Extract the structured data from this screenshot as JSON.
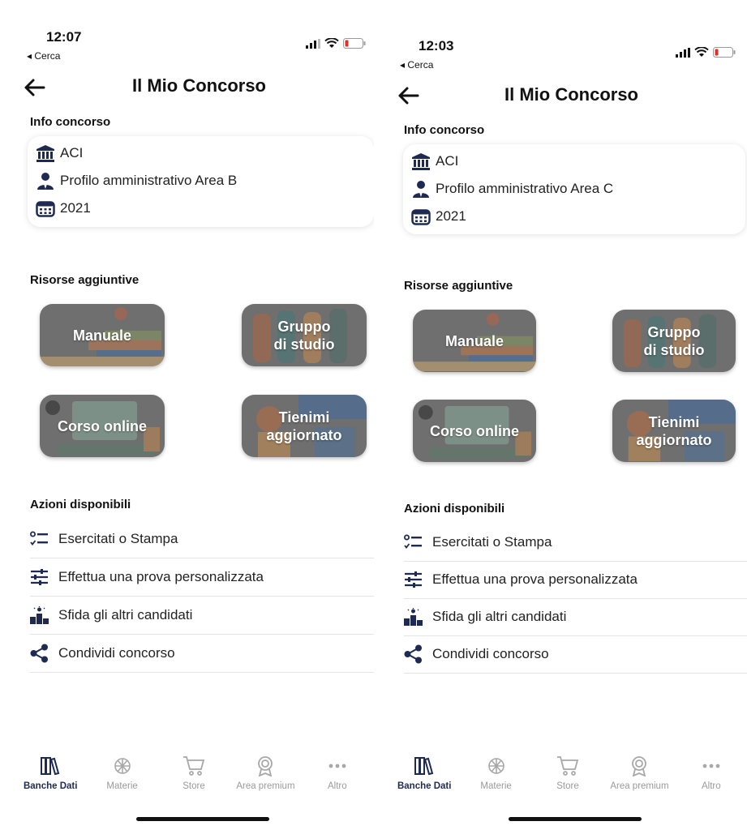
{
  "screens": [
    {
      "status": {
        "time": "12:07",
        "back_app": "◂ Cerca"
      },
      "header": {
        "title": "Il Mio Concorso"
      },
      "info": {
        "section_label": "Info concorso",
        "ente": "ACI",
        "profilo": "Profilo amministrativo Area B",
        "anno": "2021"
      },
      "resources": {
        "section_label": "Risorse aggiuntive",
        "manuale": "Manuale",
        "gruppo": "Gruppo\ndi studio",
        "corso": "Corso online",
        "tienimi": "Tienimi\naggiornato"
      },
      "actions": {
        "section_label": "Azioni disponibili",
        "items": [
          "Esercitati o Stampa",
          "Effettua una prova personalizzata",
          "Sfida gli altri candidati",
          "Condividi concorso"
        ]
      },
      "tabs": [
        "Banche Dati",
        "Materie",
        "Store",
        "Area premium",
        "Altro"
      ]
    },
    {
      "status": {
        "time": "12:03",
        "back_app": "◂ Cerca"
      },
      "header": {
        "title": "Il Mio Concorso"
      },
      "info": {
        "section_label": "Info concorso",
        "ente": "ACI",
        "profilo": "Profilo amministrativo Area C",
        "anno": "2021"
      },
      "resources": {
        "section_label": "Risorse aggiuntive",
        "manuale": "Manuale",
        "gruppo": "Gruppo\ndi studio",
        "corso": "Corso online",
        "tienimi": "Tienimi\naggiornato"
      },
      "actions": {
        "section_label": "Azioni disponibili",
        "items": [
          "Esercitati o Stampa",
          "Effettua una prova personalizzata",
          "Sfida gli altri candidati",
          "Condividi concorso"
        ]
      },
      "tabs": [
        "Banche Dati",
        "Materie",
        "Store",
        "Area premium",
        "Altro"
      ]
    }
  ],
  "icons": {
    "ente": "bank-icon",
    "profilo": "person-icon",
    "anno": "calendar-icon",
    "actions": [
      "list-check-icon",
      "sliders-icon",
      "podium-icon",
      "share-icon"
    ],
    "tabs": [
      "books-icon",
      "materie-icon",
      "cart-icon",
      "badge-icon",
      "more-icon"
    ]
  },
  "colors": {
    "navy": "#1e2a52",
    "tab_inactive": "#9a9a9a",
    "button_overlay": "#6f6f6f",
    "battery_low": "#e0302a"
  },
  "active_tab": "Banche Dati"
}
